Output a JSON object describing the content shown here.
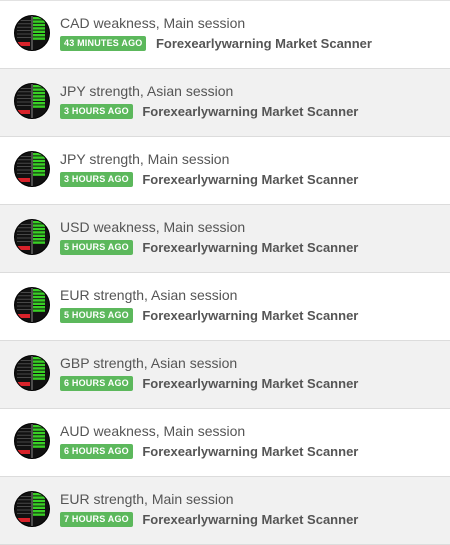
{
  "feed": {
    "items": [
      {
        "title": "CAD weakness, Main session",
        "time": "43 MINUTES AGO",
        "source": "Forexearlywarning Market Scanner"
      },
      {
        "title": "JPY strength, Asian session",
        "time": "3 HOURS AGO",
        "source": "Forexearlywarning Market Scanner"
      },
      {
        "title": "JPY strength, Main session",
        "time": "3 HOURS AGO",
        "source": "Forexearlywarning Market Scanner"
      },
      {
        "title": "USD weakness, Main session",
        "time": "5 HOURS AGO",
        "source": "Forexearlywarning Market Scanner"
      },
      {
        "title": "EUR strength, Asian session",
        "time": "5 HOURS AGO",
        "source": "Forexearlywarning Market Scanner"
      },
      {
        "title": "GBP strength, Asian session",
        "time": "6 HOURS AGO",
        "source": "Forexearlywarning Market Scanner"
      },
      {
        "title": "AUD weakness, Main session",
        "time": "6 HOURS AGO",
        "source": "Forexearlywarning Market Scanner"
      },
      {
        "title": "EUR strength, Main session",
        "time": "7 HOURS AGO",
        "source": "Forexearlywarning Market Scanner"
      }
    ]
  },
  "colors": {
    "badge": "#5cb85c",
    "strength_bar": "#39d025",
    "weakness_bar": "#d8222a",
    "avatar_bg": "#111111",
    "alt_row": "#f1f1f1"
  },
  "icons": {
    "avatar": "market-scanner-avatar-icon"
  }
}
